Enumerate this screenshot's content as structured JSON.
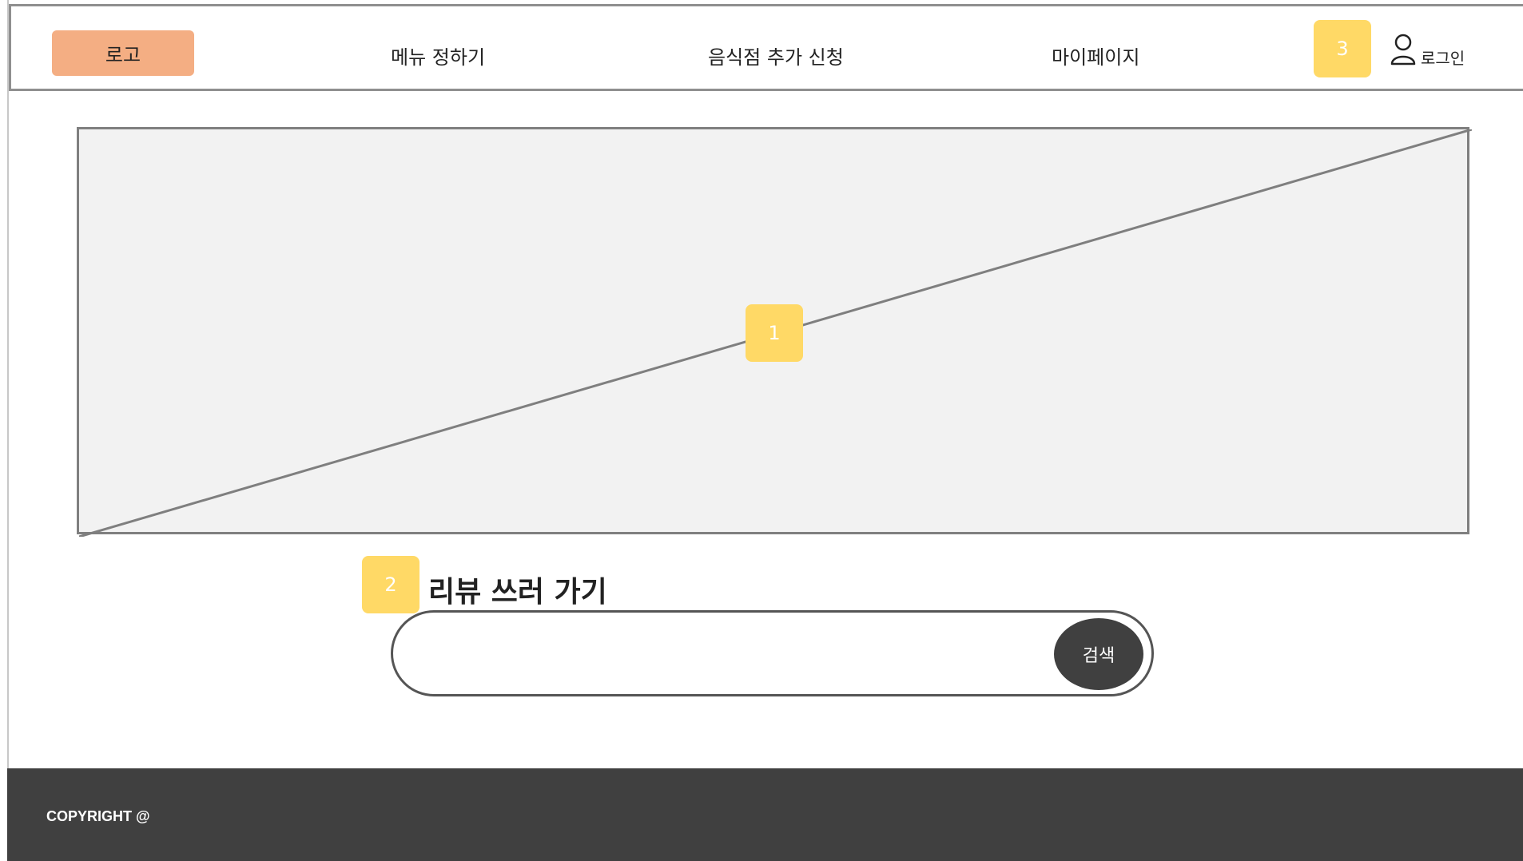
{
  "header": {
    "logo_label": "로고",
    "nav": {
      "menu_pick": "메뉴 정하기",
      "restaurant_request": "음식점 추가 신청",
      "mypage": "마이페이지"
    },
    "login_label": "로그인",
    "login_icon": "user-icon"
  },
  "annotations": {
    "badge1": "1",
    "badge2": "2",
    "badge3": "3"
  },
  "hero": {
    "type": "image-placeholder"
  },
  "review": {
    "title": "리뷰 쓰러 가기"
  },
  "search": {
    "placeholder": "",
    "button_label": "검색"
  },
  "footer": {
    "copyright": "COPYRIGHT @"
  },
  "colors": {
    "logo_bg": "#f4ae83",
    "badge": "#ffd966",
    "footer_bg": "#404040",
    "search_button_bg": "#404040",
    "placeholder_bg": "#f2f2f2"
  }
}
